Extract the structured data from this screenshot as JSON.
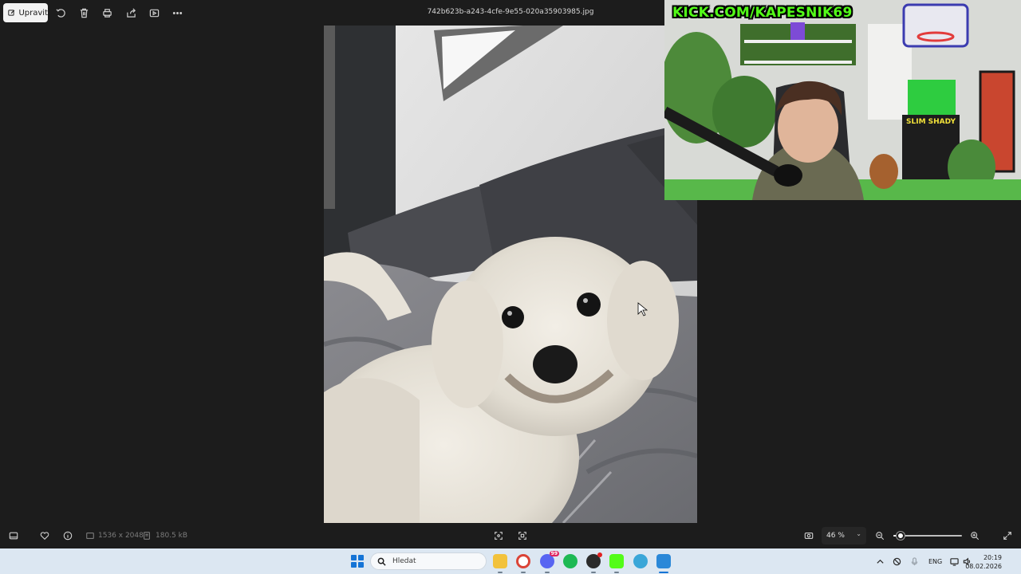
{
  "toolbar": {
    "edit_label": "Upravit",
    "icons": [
      "edit-icon",
      "rotate-icon",
      "delete-icon",
      "print-icon",
      "share-icon",
      "slideshow-icon",
      "more-icon"
    ],
    "filename": "742b623b-a243-4cfe-9e55-020a35903985.jpg"
  },
  "photo": {
    "subject": "white bichon dog lying on grey bedding"
  },
  "webcam": {
    "overlay_text": "KICK.COM/KAPESNIK69",
    "poster_text": "SLIM SHADY"
  },
  "bottom_bar": {
    "dimensions": "1536 x 2048",
    "file_size": "180.5 kB",
    "zoom": "46 %",
    "zoom_slider_fraction": 0.1,
    "icons": [
      "filmstrip-icon",
      "favorite-icon",
      "info-icon",
      "dimensions-icon",
      "filesize-icon",
      "fit-to-window-icon",
      "actual-size-icon",
      "screenshot-icon",
      "zoom-out-icon",
      "zoom-in-icon",
      "fullscreen-icon"
    ]
  },
  "taskbar": {
    "search_placeholder": "Hledat",
    "apps": [
      "file-explorer-icon",
      "chrome-icon",
      "discord-icon",
      "spotify-icon",
      "obs-icon",
      "kick-icon",
      "edge-icon",
      "photos-icon"
    ],
    "discord_badge": "99",
    "language": "ENG",
    "time": "20:19",
    "date": "08.02.2026",
    "accent": "#1574d6"
  }
}
